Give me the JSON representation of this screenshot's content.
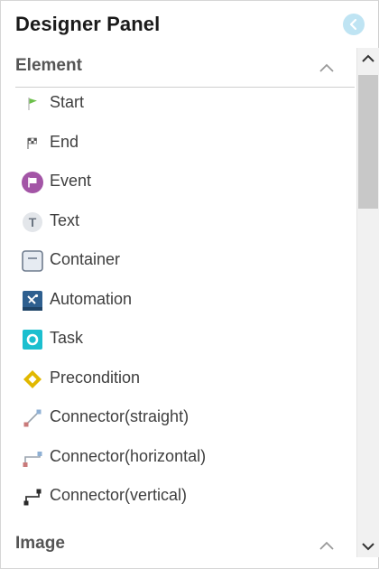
{
  "panel": {
    "title": "Designer Panel"
  },
  "sections": [
    {
      "title": "Element",
      "items": [
        {
          "label": "Start",
          "icon": "start-flag-icon"
        },
        {
          "label": "End",
          "icon": "checkered-flag-icon"
        },
        {
          "label": "Event",
          "icon": "event-flag-icon"
        },
        {
          "label": "Text",
          "icon": "text-icon"
        },
        {
          "label": "Container",
          "icon": "container-icon"
        },
        {
          "label": "Automation",
          "icon": "automation-icon"
        },
        {
          "label": "Task",
          "icon": "task-icon"
        },
        {
          "label": "Precondition",
          "icon": "precondition-icon"
        },
        {
          "label": "Connector(straight)",
          "icon": "connector-straight-icon"
        },
        {
          "label": "Connector(horizontal)",
          "icon": "connector-horizontal-icon"
        },
        {
          "label": "Connector(vertical)",
          "icon": "connector-vertical-icon"
        }
      ]
    },
    {
      "title": "Image",
      "items": []
    }
  ],
  "colors": {
    "start": "#6cc04a",
    "event": "#a355a6",
    "automation": "#2e5f8f",
    "task": "#1cbfcf",
    "precondition": "#e1b800",
    "collapse": "#bfe4f3"
  }
}
